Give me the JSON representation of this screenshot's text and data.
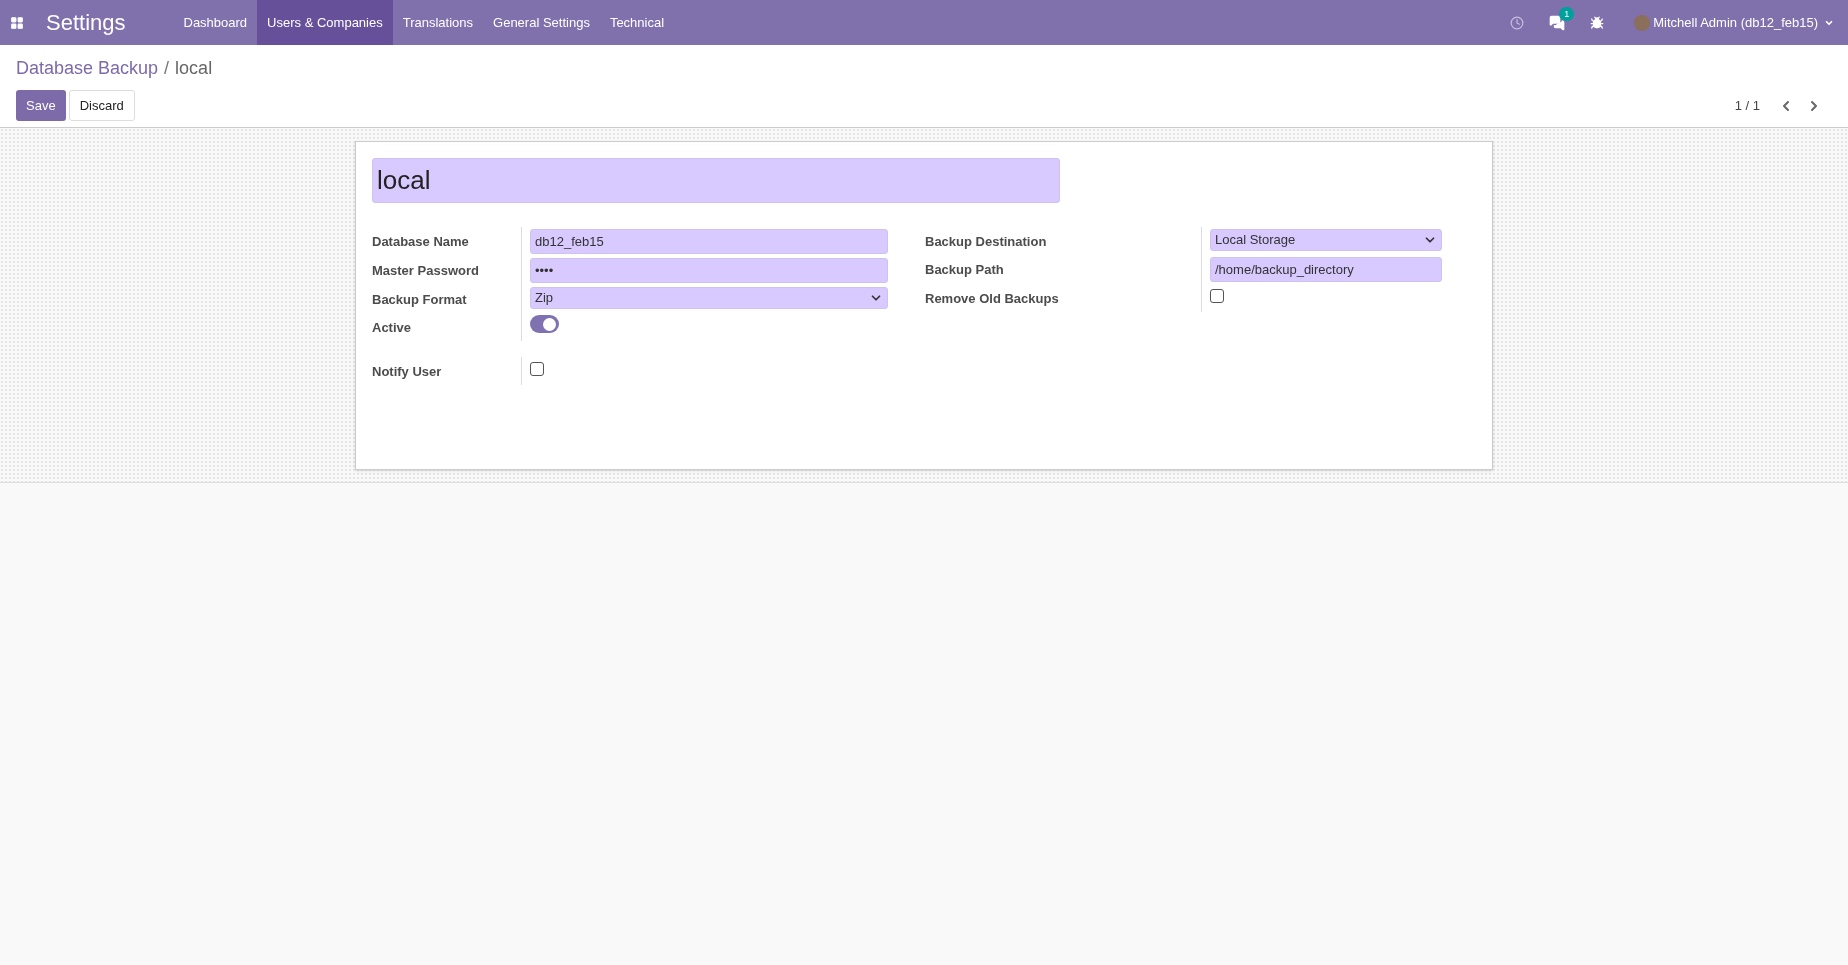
{
  "navbar": {
    "app_title": "Settings",
    "menu": [
      {
        "label": "Dashboard",
        "selected": false
      },
      {
        "label": "Users & Companies",
        "selected": true
      },
      {
        "label": "Translations",
        "selected": false
      },
      {
        "label": "General Settings",
        "selected": false
      },
      {
        "label": "Technical",
        "selected": false
      }
    ],
    "messages_badge": "1",
    "user": "Mitchell Admin (db12_feb15)"
  },
  "breadcrumb": {
    "parent": "Database Backup",
    "separator": "/",
    "current": "local"
  },
  "buttons": [
    "Save",
    "Discard"
  ],
  "pager": "1 / 1",
  "form": {
    "name": "local",
    "left_fields": [
      {
        "kind": "text",
        "label": "Database Name",
        "value": "db12_feb15"
      },
      {
        "kind": "text",
        "label": "Master Password",
        "value": "••••"
      },
      {
        "kind": "select",
        "label": "Backup Format",
        "value": "Zip"
      },
      {
        "kind": "toggle",
        "label": "Active",
        "on": true
      }
    ],
    "right_fields": [
      {
        "kind": "select",
        "label": "Backup Destination",
        "value": "Local Storage"
      },
      {
        "kind": "text",
        "label": "Backup Path",
        "value": "/home/backup_directory"
      },
      {
        "kind": "checkbox",
        "label": "Remove Old Backups",
        "checked": false
      }
    ],
    "bottom_fields": [
      {
        "kind": "checkbox",
        "label": "Notify User",
        "checked": false
      }
    ]
  }
}
